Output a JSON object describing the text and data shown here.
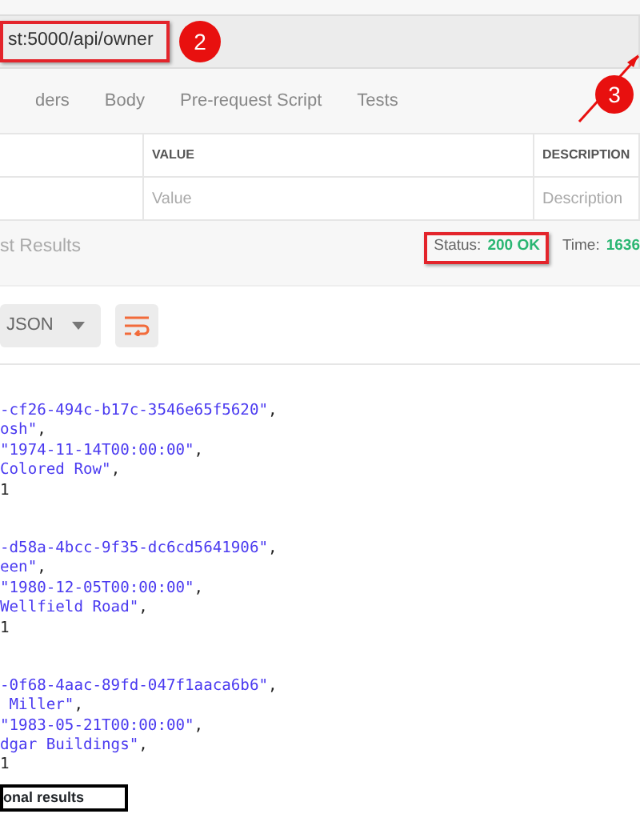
{
  "request": {
    "url": "st:5000/api/owner"
  },
  "callouts": [
    {
      "number": "2"
    },
    {
      "number": "3"
    }
  ],
  "tabs": [
    {
      "label": "ders"
    },
    {
      "label": "Body"
    },
    {
      "label": "Pre-request Script"
    },
    {
      "label": "Tests"
    }
  ],
  "params_table": {
    "columns": [
      {
        "header": "VALUE",
        "placeholder": "Value"
      },
      {
        "header": "DESCRIPTION",
        "placeholder": "Description"
      }
    ]
  },
  "response_bar": {
    "tab": "st Results",
    "status_label": "Status:",
    "status": "200 OK",
    "time_label": "Time:",
    "time": "1636"
  },
  "format": {
    "label": "JSON"
  },
  "body": [
    {
      "lines": [
        [
          {
            "kind": "string",
            "text": "-cf26-494c-b17c-3546e65f5620\""
          },
          {
            "kind": "punct",
            "text": ","
          }
        ],
        [
          {
            "kind": "string",
            "text": "osh\""
          },
          {
            "kind": "punct",
            "text": ","
          }
        ],
        [
          {
            "kind": "string",
            "text": "\"1974-11-14T00:00:00\""
          },
          {
            "kind": "punct",
            "text": ","
          }
        ],
        [
          {
            "kind": "string",
            "text": "Colored Row\""
          },
          {
            "kind": "punct",
            "text": ","
          }
        ],
        [
          {
            "kind": "number",
            "text": "1"
          }
        ]
      ]
    },
    {
      "lines": [
        [
          {
            "kind": "string",
            "text": "-d58a-4bcc-9f35-dc6cd5641906\""
          },
          {
            "kind": "punct",
            "text": ","
          }
        ],
        [
          {
            "kind": "string",
            "text": "een\""
          },
          {
            "kind": "punct",
            "text": ","
          }
        ],
        [
          {
            "kind": "string",
            "text": "\"1980-12-05T00:00:00\""
          },
          {
            "kind": "punct",
            "text": ","
          }
        ],
        [
          {
            "kind": "string",
            "text": "Wellfield Road\""
          },
          {
            "kind": "punct",
            "text": ","
          }
        ],
        [
          {
            "kind": "number",
            "text": "1"
          }
        ]
      ]
    },
    {
      "lines": [
        [
          {
            "kind": "string",
            "text": "-0f68-4aac-89fd-047f1aaca6b6\""
          },
          {
            "kind": "punct",
            "text": ","
          }
        ],
        [
          {
            "kind": "string",
            "text": " Miller\""
          },
          {
            "kind": "punct",
            "text": ","
          }
        ],
        [
          {
            "kind": "string",
            "text": "\"1983-05-21T00:00:00\""
          },
          {
            "kind": "punct",
            "text": ","
          }
        ],
        [
          {
            "kind": "string",
            "text": "dgar Buildings\""
          },
          {
            "kind": "punct",
            "text": ","
          }
        ],
        [
          {
            "kind": "number",
            "text": "1"
          }
        ]
      ]
    }
  ],
  "caption": "onal results"
}
